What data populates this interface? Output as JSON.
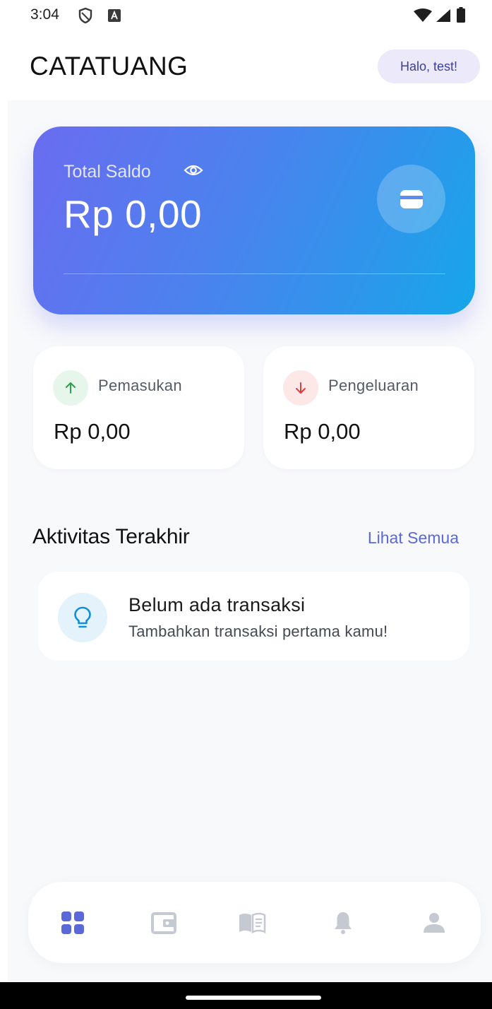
{
  "status_bar": {
    "time": "3:04",
    "icons": [
      "shield-icon",
      "a-icon",
      "wifi-icon",
      "signal-icon",
      "battery-icon"
    ]
  },
  "header": {
    "app_title": "CATATUANG",
    "greeting": "Halo, test!"
  },
  "balance_card": {
    "label": "Total Saldo",
    "amount": "Rp 0,00",
    "icons": [
      "eye-icon",
      "wallet-icon"
    ]
  },
  "summary": {
    "income": {
      "label": "Pemasukan",
      "value": "Rp 0,00",
      "icon": "arrow-up-icon",
      "color": "#2e9e4f"
    },
    "expense": {
      "label": "Pengeluaran",
      "value": "Rp 0,00",
      "icon": "arrow-down-icon",
      "color": "#e23b3b"
    }
  },
  "recent": {
    "title": "Aktivitas Terakhir",
    "see_all": "Lihat Semua",
    "empty_title": "Belum ada transaksi",
    "empty_subtitle": "Tambahkan transaksi pertama kamu!",
    "icon": "lightbulb-icon"
  },
  "bottom_nav": {
    "items": [
      {
        "name": "home",
        "icon": "grid-icon",
        "active": true
      },
      {
        "name": "wallet",
        "icon": "wallet-icon",
        "active": false
      },
      {
        "name": "book",
        "icon": "book-icon",
        "active": false
      },
      {
        "name": "notifications",
        "icon": "bell-icon",
        "active": false
      },
      {
        "name": "profile",
        "icon": "person-icon",
        "active": false
      }
    ]
  },
  "colors": {
    "accent": "#5a68d8",
    "card_gradient_start": "#6a6cf0",
    "card_gradient_end": "#16a6e9",
    "background": "#f8f9fb",
    "nav_inactive": "#c5c9d2"
  }
}
